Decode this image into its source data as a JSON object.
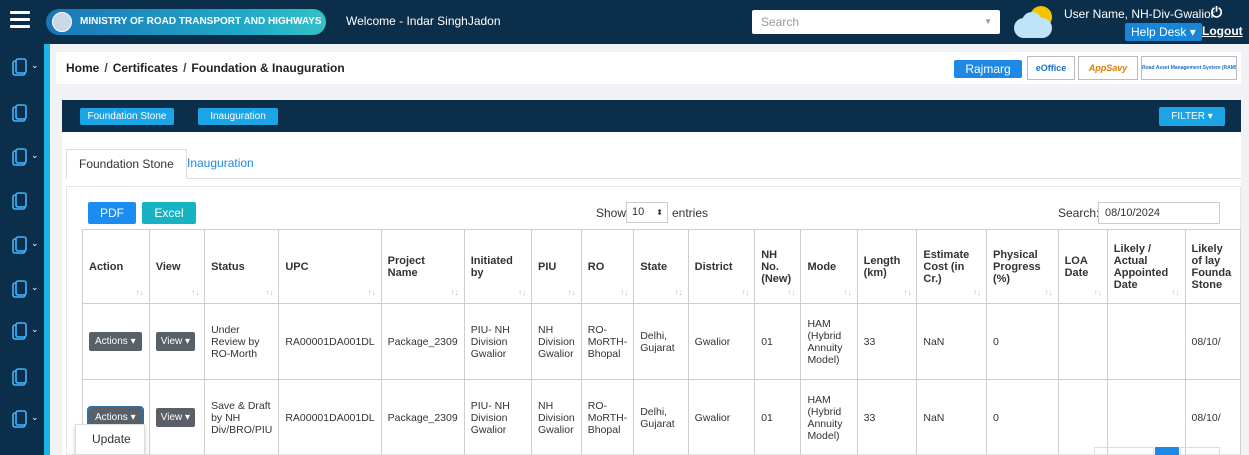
{
  "header": {
    "ministry": "MINISTRY OF ROAD TRANSPORT AND HIGHWAYS",
    "welcome": "Welcome - Indar SinghJadon",
    "search_placeholder": "Search",
    "user_name": "User Name, NH-Div-Gwalior",
    "help_desk": "Help Desk",
    "logout": "Logout"
  },
  "breadcrumb": {
    "home": "Home",
    "certificates": "Certificates",
    "current": "Foundation & Inauguration"
  },
  "quick_links": {
    "rajmarg": "Rajmarg",
    "eoffice": "eOffice",
    "appsavy": "AppSavy",
    "ramis": "Road Asset Management System (RAMS)"
  },
  "panel": {
    "btn_foundation": "Foundation Stone",
    "btn_inauguration": "Inauguration",
    "filter": "FILTER"
  },
  "tabs": [
    "Foundation Stone",
    "Inauguration"
  ],
  "controls": {
    "pdf": "PDF",
    "excel": "Excel",
    "show": "Show",
    "entries_value": "10",
    "entries": "entries",
    "search_label": "Search:",
    "search_value": "08/10/2024"
  },
  "table": {
    "headers": [
      "Action",
      "View",
      "Status",
      "UPC",
      "Project Name",
      "Initiated by",
      "PIU",
      "RO",
      "State",
      "District",
      "NH No. (New)",
      "Mode",
      "Length (km)",
      "Estimate Cost (in Cr.)",
      "Physical Progress (%)",
      "LOA Date",
      "Likely / Actual Appointed Date",
      "Likely of lay Founda Stone"
    ],
    "rows": [
      {
        "action": "Actions",
        "view": "View",
        "status": "Under Review by RO-Morth",
        "upc": "RA00001DA001DL",
        "project": "Package_2309",
        "initiated": "PIU- NH Division Gwalior",
        "piu": "NH Division Gwalior",
        "ro": "RO- MoRTH- Bhopal",
        "state": "Delhi, Gujarat",
        "district": "Gwalior",
        "nh": "01",
        "mode": "HAM (Hybrid Annuity Model)",
        "length": "33",
        "cost": "NaN",
        "progress": "0",
        "loa": "",
        "appointed": "",
        "foundation": "08/10/"
      },
      {
        "action": "Actions",
        "view": "View",
        "status": "Save & Draft by NH Div/BRO/PIU",
        "upc": "RA00001DA001DL",
        "project": "Package_2309",
        "initiated": "PIU- NH Division Gwalior",
        "piu": "NH Division Gwalior",
        "ro": "RO- MoRTH- Bhopal",
        "state": "Delhi, Gujarat",
        "district": "Gwalior",
        "nh": "01",
        "mode": "HAM (Hybrid Annuity Model)",
        "length": "33",
        "cost": "NaN",
        "progress": "0",
        "loa": "",
        "appointed": "",
        "foundation": "08/10/"
      }
    ]
  },
  "dropdown": {
    "update": "Update"
  }
}
